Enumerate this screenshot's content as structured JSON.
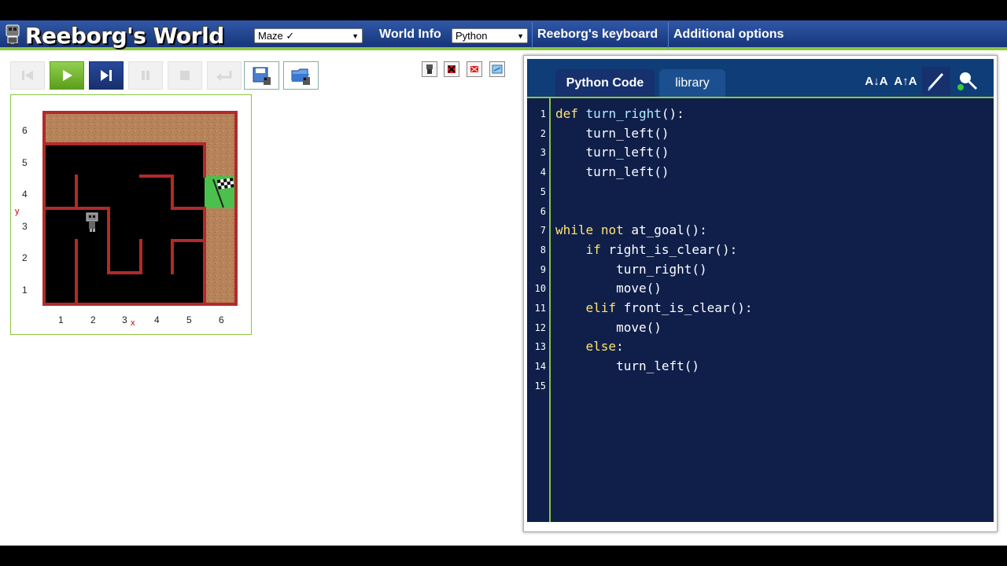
{
  "header": {
    "title": "Reeborg's World",
    "world_select": "Maze ✓",
    "world_info": "World Info",
    "language_select": "Python",
    "keyboard": "Reeborg's keyboard",
    "options": "Additional options"
  },
  "toolbar": {
    "buttons": [
      "reload-icon",
      "run-icon",
      "step-icon",
      "pause-icon",
      "stop-icon",
      "return-icon",
      "save-world-icon",
      "open-world-icon"
    ],
    "small_buttons": [
      "robot-icon",
      "clear-robot-icon",
      "delete-icon",
      "edit-world-icon"
    ]
  },
  "world": {
    "x_ticks": [
      "1",
      "2",
      "3",
      "4",
      "5",
      "6"
    ],
    "y_ticks": [
      "1",
      "2",
      "3",
      "4",
      "5",
      "6"
    ],
    "x_letter": "x",
    "y_letter": "y",
    "robot": {
      "x": 2,
      "y": 3,
      "facing": "south"
    },
    "goal": {
      "x": 6,
      "y": 4
    }
  },
  "editor": {
    "tabs": [
      "Python Code",
      "library"
    ],
    "active_tab": "Python Code",
    "icons": [
      "decrease-font-icon",
      "increase-font-icon",
      "highlight-icon",
      "watch-icon"
    ],
    "font_labels": [
      "A↓A",
      "A↑A"
    ],
    "lines": [
      "def turn_right():",
      "    turn_left()",
      "    turn_left()",
      "    turn_left()",
      "",
      "",
      "while not at_goal():",
      "    if right_is_clear():",
      "        turn_right()",
      "        move()",
      "    elif front_is_clear():",
      "        move()",
      "    else:",
      "        turn_left()",
      ""
    ]
  },
  "colors": {
    "header_top": "#3058a8",
    "header_bottom": "#17367a",
    "accent_green": "#8cc63f",
    "editor_bg": "#0f1f4a",
    "wall": "#b22a2a",
    "keyword": "#ffe46b"
  }
}
